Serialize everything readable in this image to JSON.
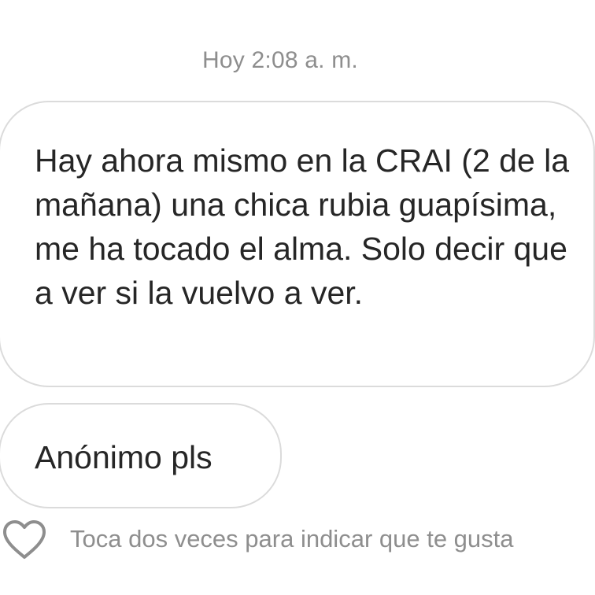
{
  "thread": {
    "timestamp": "Hoy 2:08 a. m."
  },
  "messages": [
    {
      "text": "Hay ahora mismo en la CRAI (2 de la mañana) una chica rubia guapísima, me ha tocado el alma. Solo decir que a ver si la vuelvo a ver."
    },
    {
      "text": "Anónimo pls"
    }
  ],
  "reaction": {
    "icon": "heart-outline-icon",
    "hint": "Toca dos veces para indicar que te gusta"
  }
}
